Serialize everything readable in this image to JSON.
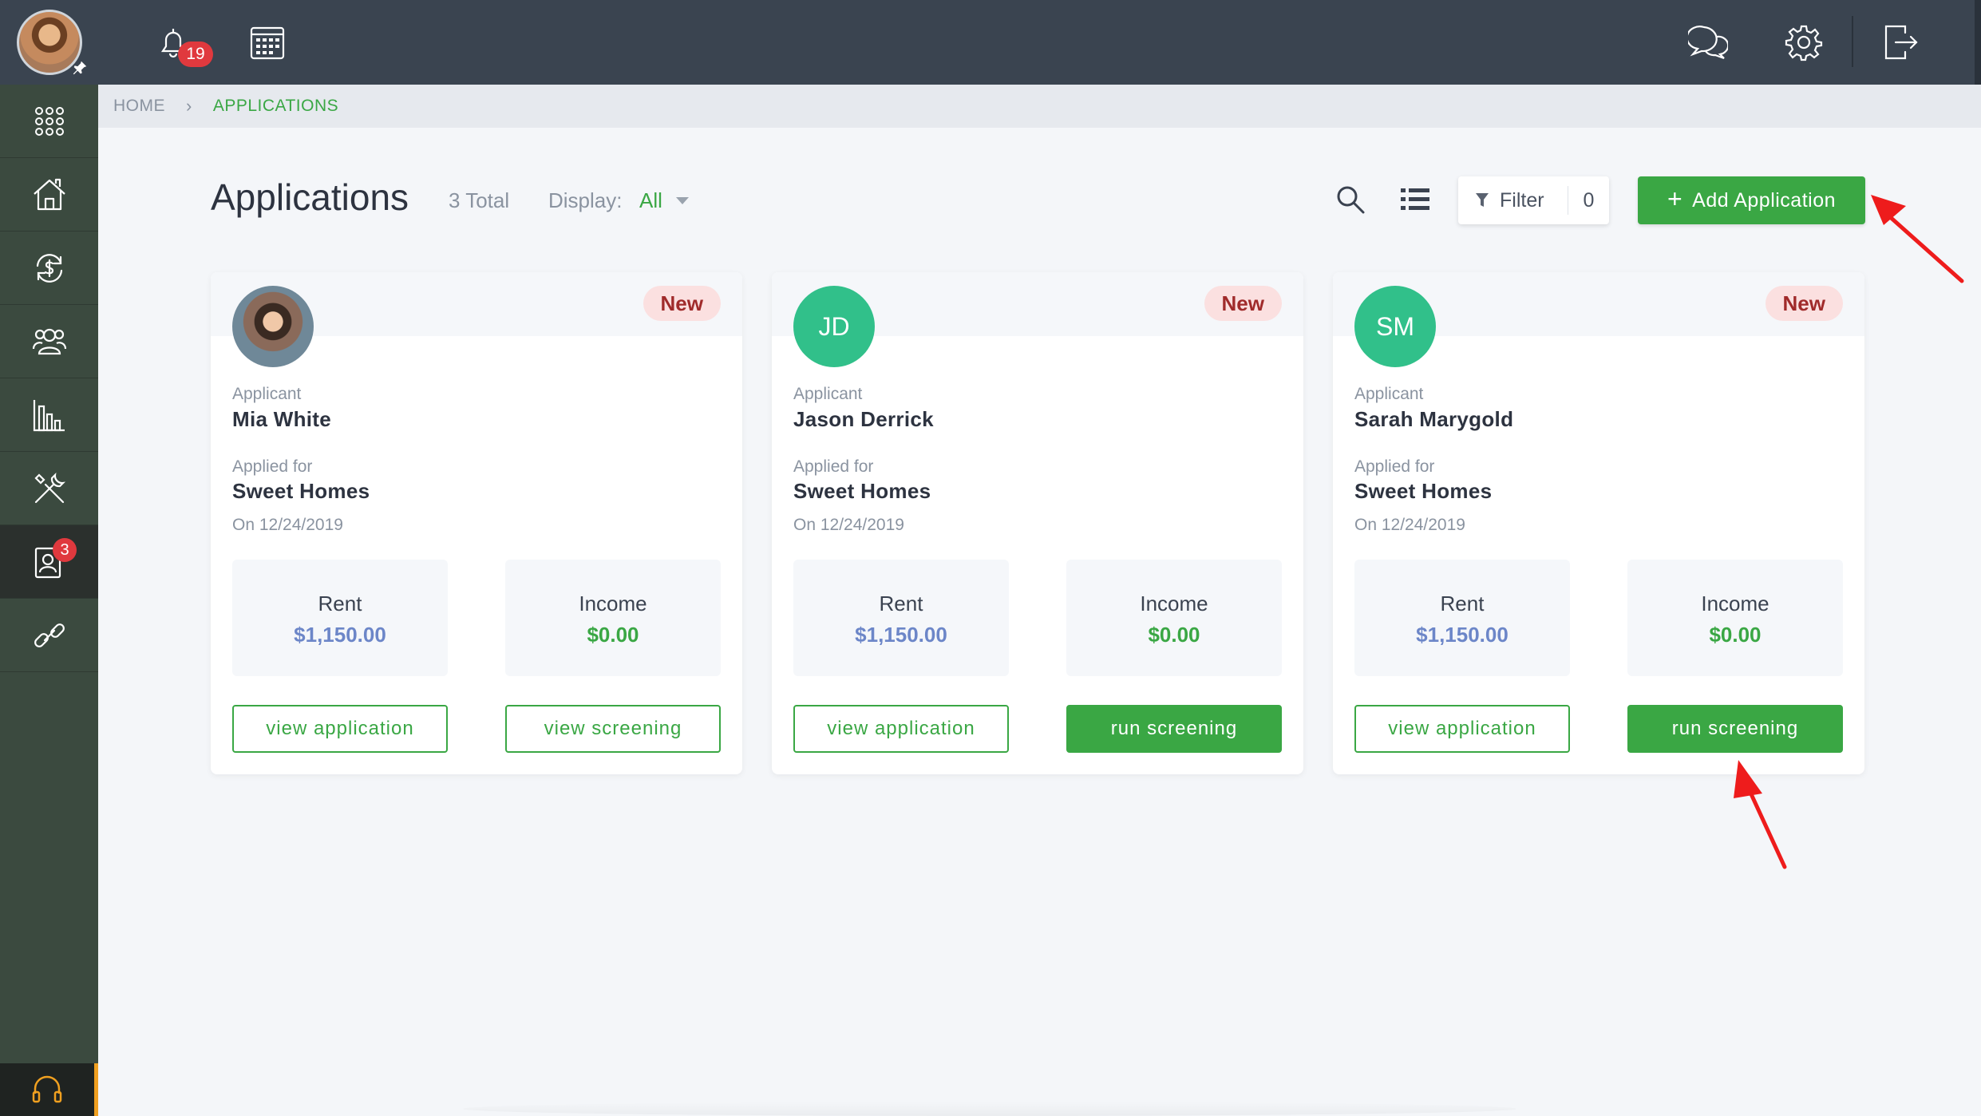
{
  "topbar": {
    "notification_count": "19"
  },
  "sidebar": {
    "items": [
      {
        "name": "apps"
      },
      {
        "name": "properties"
      },
      {
        "name": "accounting"
      },
      {
        "name": "people"
      },
      {
        "name": "reports"
      },
      {
        "name": "maintenance"
      },
      {
        "name": "applications",
        "badge": "3"
      },
      {
        "name": "integrations"
      }
    ]
  },
  "breadcrumb": {
    "home": "HOME",
    "current": "APPLICATIONS"
  },
  "header": {
    "title": "Applications",
    "total": "3 Total",
    "display_label": "Display:",
    "display_value": "All",
    "filter_label": "Filter",
    "filter_count": "0",
    "add_button": "Add Application"
  },
  "cards": [
    {
      "badge": "New",
      "avatar_initials": "",
      "applicant_label": "Applicant",
      "applicant_name": "Mia White",
      "applied_label": "Applied for",
      "property": "Sweet Homes",
      "date": "On 12/24/2019",
      "rent_label": "Rent",
      "rent_value": "$1,150.00",
      "income_label": "Income",
      "income_value": "$0.00",
      "left_button": "view application",
      "right_button": "view screening"
    },
    {
      "badge": "New",
      "avatar_initials": "JD",
      "applicant_label": "Applicant",
      "applicant_name": "Jason Derrick",
      "applied_label": "Applied for",
      "property": "Sweet Homes",
      "date": "On 12/24/2019",
      "rent_label": "Rent",
      "rent_value": "$1,150.00",
      "income_label": "Income",
      "income_value": "$0.00",
      "left_button": "view application",
      "right_button": "run screening"
    },
    {
      "badge": "New",
      "avatar_initials": "SM",
      "applicant_label": "Applicant",
      "applicant_name": "Sarah Marygold",
      "applied_label": "Applied for",
      "property": "Sweet Homes",
      "date": "On 12/24/2019",
      "rent_label": "Rent",
      "rent_value": "$1,150.00",
      "income_label": "Income",
      "income_value": "$0.00",
      "left_button": "view application",
      "right_button": "run screening"
    }
  ],
  "colors": {
    "accent_green": "#3aa744",
    "topbar": "#3a4450",
    "sidebar": "#3b4a3f",
    "badge_red": "#e0393e",
    "rent_blue": "#6c86c8",
    "initials_avatar": "#31c08a"
  }
}
